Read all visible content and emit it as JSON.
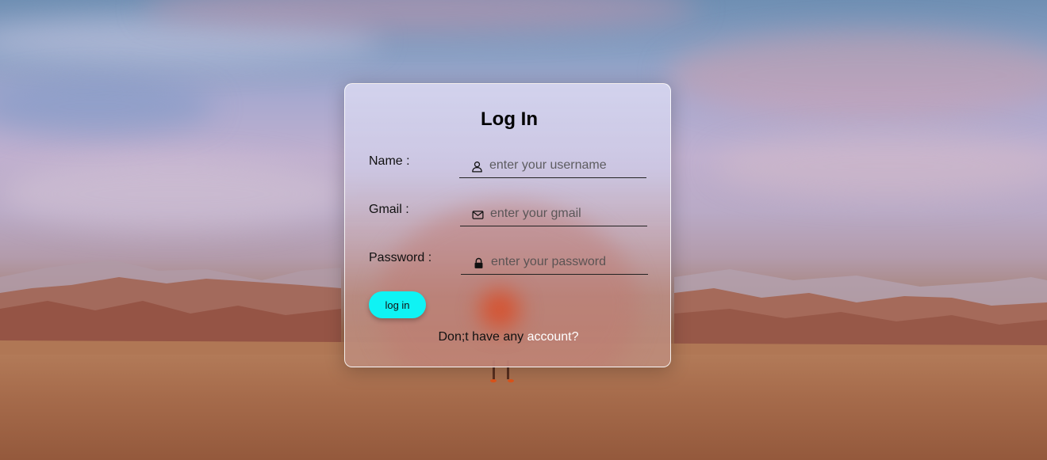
{
  "form": {
    "title": "Log In",
    "fields": [
      {
        "label": "Name :",
        "placeholder": "enter your username",
        "value": "",
        "icon": "user-icon"
      },
      {
        "label": "Gmail :",
        "placeholder": "enter your gmail",
        "value": "",
        "icon": "mail-icon"
      },
      {
        "label": "Password :",
        "placeholder": "enter your password",
        "value": "",
        "icon": "lock-icon"
      }
    ],
    "submit_label": "log in",
    "signup_text": "Don;t have any",
    "signup_link": "account?"
  },
  "colors": {
    "button": "#0ff3f4",
    "link": "#ffffff"
  }
}
